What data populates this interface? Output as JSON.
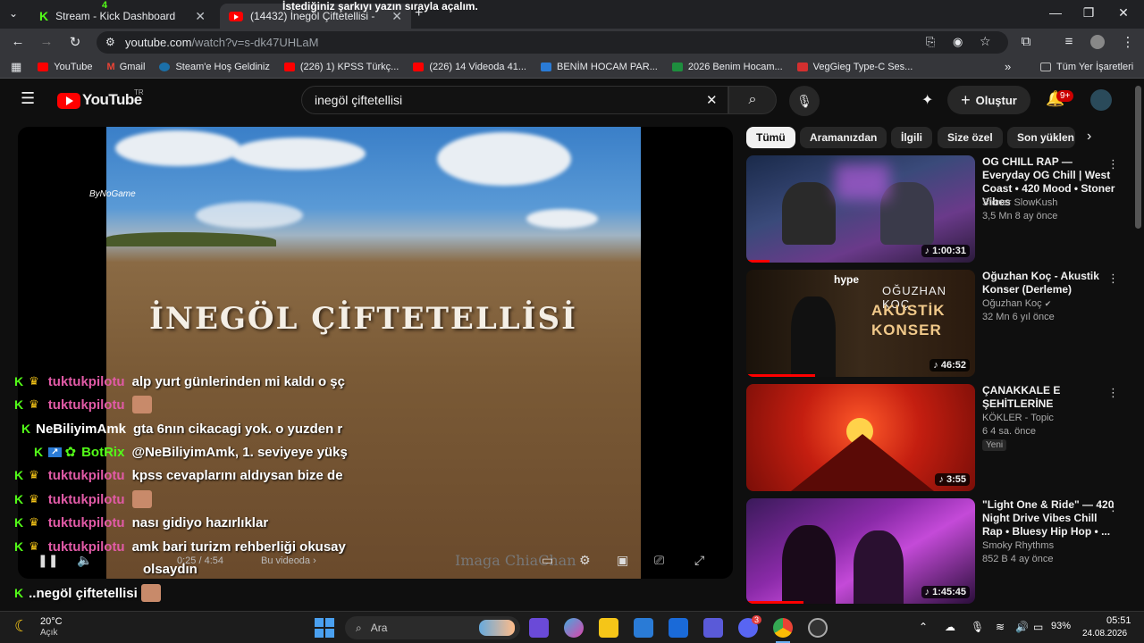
{
  "browser": {
    "tabs": [
      {
        "title": "Stream - Kick Dashboard",
        "badge": "4"
      },
      {
        "title": "(14432) İnegöl Çiftetellisi - "
      }
    ],
    "overlay_notice": "İstediğiniz şarkıyı yazın sırayla açalım.",
    "url_host": "youtube.com",
    "url_path": "/watch?v=s-dk47UHLaM",
    "bookmarks": [
      "YouTube",
      "Gmail",
      "Steam'e Hoş Geldiniz",
      "(226) 1) KPSS Türkç...",
      "(226) 14 Videoda 41...",
      "BENİM HOCAM PAR...",
      "2026 Benim Hocam...",
      "VegGieg Type-C Ses..."
    ],
    "bookmarks_more": "»",
    "all_bookmarks": "Tüm Yer İşaretleri"
  },
  "youtube": {
    "logo": "YouTube",
    "region": "TR",
    "search_value": "inegöl çiftetellisi",
    "create_label": "Oluştur",
    "notif_count": "9+"
  },
  "video": {
    "title_overlay": "İNEGÖL ÇİFTETELLİSİ",
    "watermark": "ByNoGame",
    "time": "0:25 / 4:54",
    "chapter": "Bu videoda",
    "corner_text": "Imaga ChiaChan"
  },
  "chat": [
    {
      "user": "tuktukpilotu",
      "msg": "alp yurt günlerinden mi kaldı o şç"
    },
    {
      "user": "tuktukpilotu",
      "msg": ""
    },
    {
      "user": "NeBiliyimAmk",
      "msg": "gta 6nın cikacagi yok. o yuzden r"
    },
    {
      "user": "BotRix",
      "msg": "@NeBiliyimAmk, 1. seviyeye yükş"
    },
    {
      "user": "tuktukpilotu",
      "msg": "kpss cevaplarını aldıysan bize de"
    },
    {
      "user": "tuktukpilotu",
      "msg": ""
    },
    {
      "user": "tuktukpilotu",
      "msg": "nası gidiyo hazırlıklar"
    },
    {
      "user": "tuktukpilotu",
      "msg": "amk bari turizm rehberliği okusay"
    },
    {
      "user": "",
      "msg": "olsaydın"
    },
    {
      "user": "tuktukpilotu",
      "msg": "..negöl çiftetellisi"
    }
  ],
  "chips": [
    "Tümü",
    "Aramanızdan",
    "İlgili",
    "Size özel",
    "Son yüklen"
  ],
  "recommendations": [
    {
      "title": "OG CHILL RAP — Everyday OG Chill | West Coast • 420 Mood • Stoner Vibes",
      "channel": "Stoner SlowKush",
      "meta": "3,5 Mn   8 ay önce",
      "duration": "1:00:31",
      "progress": 0.1
    },
    {
      "title": "Oğuzhan Koç - Akustik Konser (Derleme)",
      "channel": "Oğuzhan Koç",
      "meta": "32 Mn   6 yıl önce",
      "duration": "46:52",
      "thumb_text": "hype",
      "thumb_text2": "OĞUZHAN KOÇ",
      "thumb_text3": "AKUSTİK",
      "thumb_text4": "KONSER",
      "progress": 0.3
    },
    {
      "title": "ÇANAKKALE E ŞEHİTLERİNE",
      "channel": "KÖKLER - Topic",
      "meta": "6   4 sa. önce",
      "badge": "Yeni",
      "duration": "3:55",
      "progress": 0
    },
    {
      "title": "\"Light One & Ride\" — 420 Night Drive Vibes  Chill Rap • Bluesy Hip Hop • ...",
      "channel": "Smoky Rhythms",
      "meta": "852 B   4 ay önce",
      "duration": "1:45:45",
      "progress": 0.25
    }
  ],
  "taskbar": {
    "weather_temp": "20°C",
    "weather_desc": "Açık",
    "search_label": "Ara",
    "discord_badge": "3",
    "battery": "93%",
    "time": "05:51",
    "date": "24.08.2026"
  }
}
